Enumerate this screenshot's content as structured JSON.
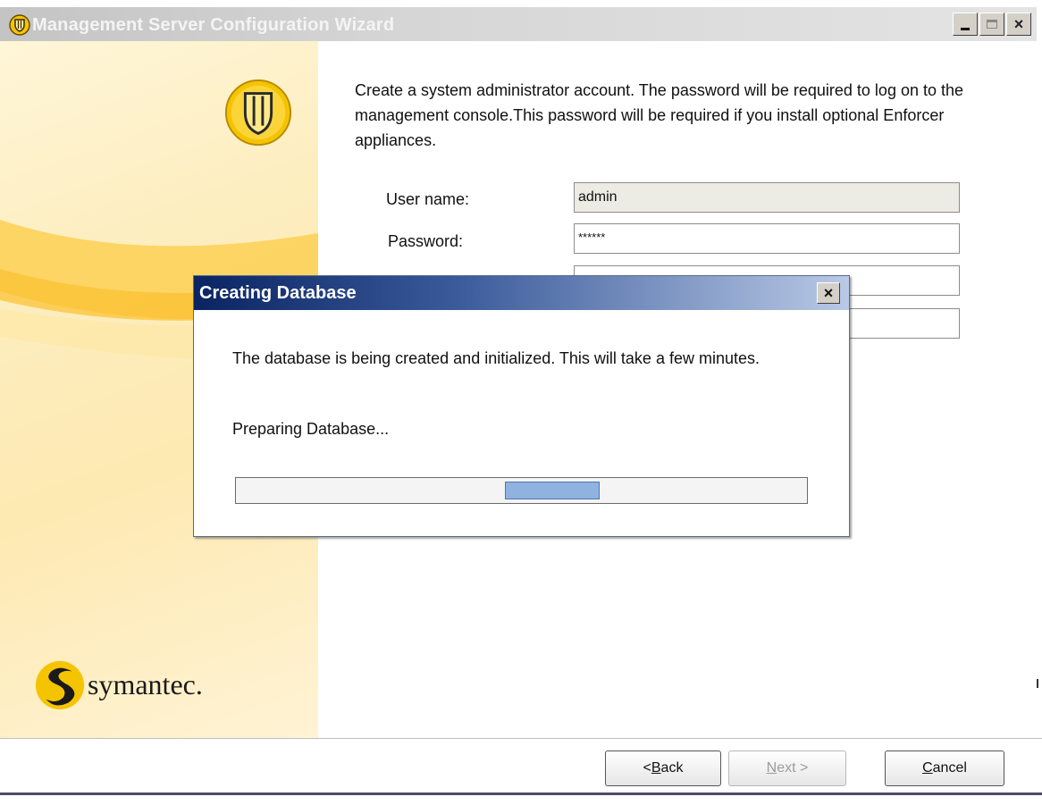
{
  "window": {
    "title": "Management Server Configuration Wizard",
    "controls": {
      "minimize": "_",
      "maximize": "□",
      "close": "×"
    }
  },
  "intro_text": "Create a system administrator account. The password will be required to log on to the management console.This password will be required if you install optional Enforcer appliances.",
  "form": {
    "username_label": "User name:",
    "username_value": "admin",
    "password_label": "Password:",
    "password_value": "******"
  },
  "brand": {
    "name": "symantec."
  },
  "buttons": {
    "back": "< Back",
    "next": "Next >",
    "cancel": "Cancel"
  },
  "dialog": {
    "title": "Creating Database",
    "close": "×",
    "message": "The database is being created and initialized. This will take a few minutes.",
    "status": "Preparing Database...",
    "progress_marquee_position": 0.47
  },
  "colors": {
    "brand_yellow": "#f5c400",
    "dialog_title": "#0a2463",
    "progress_fill": "#8fb2e0"
  }
}
